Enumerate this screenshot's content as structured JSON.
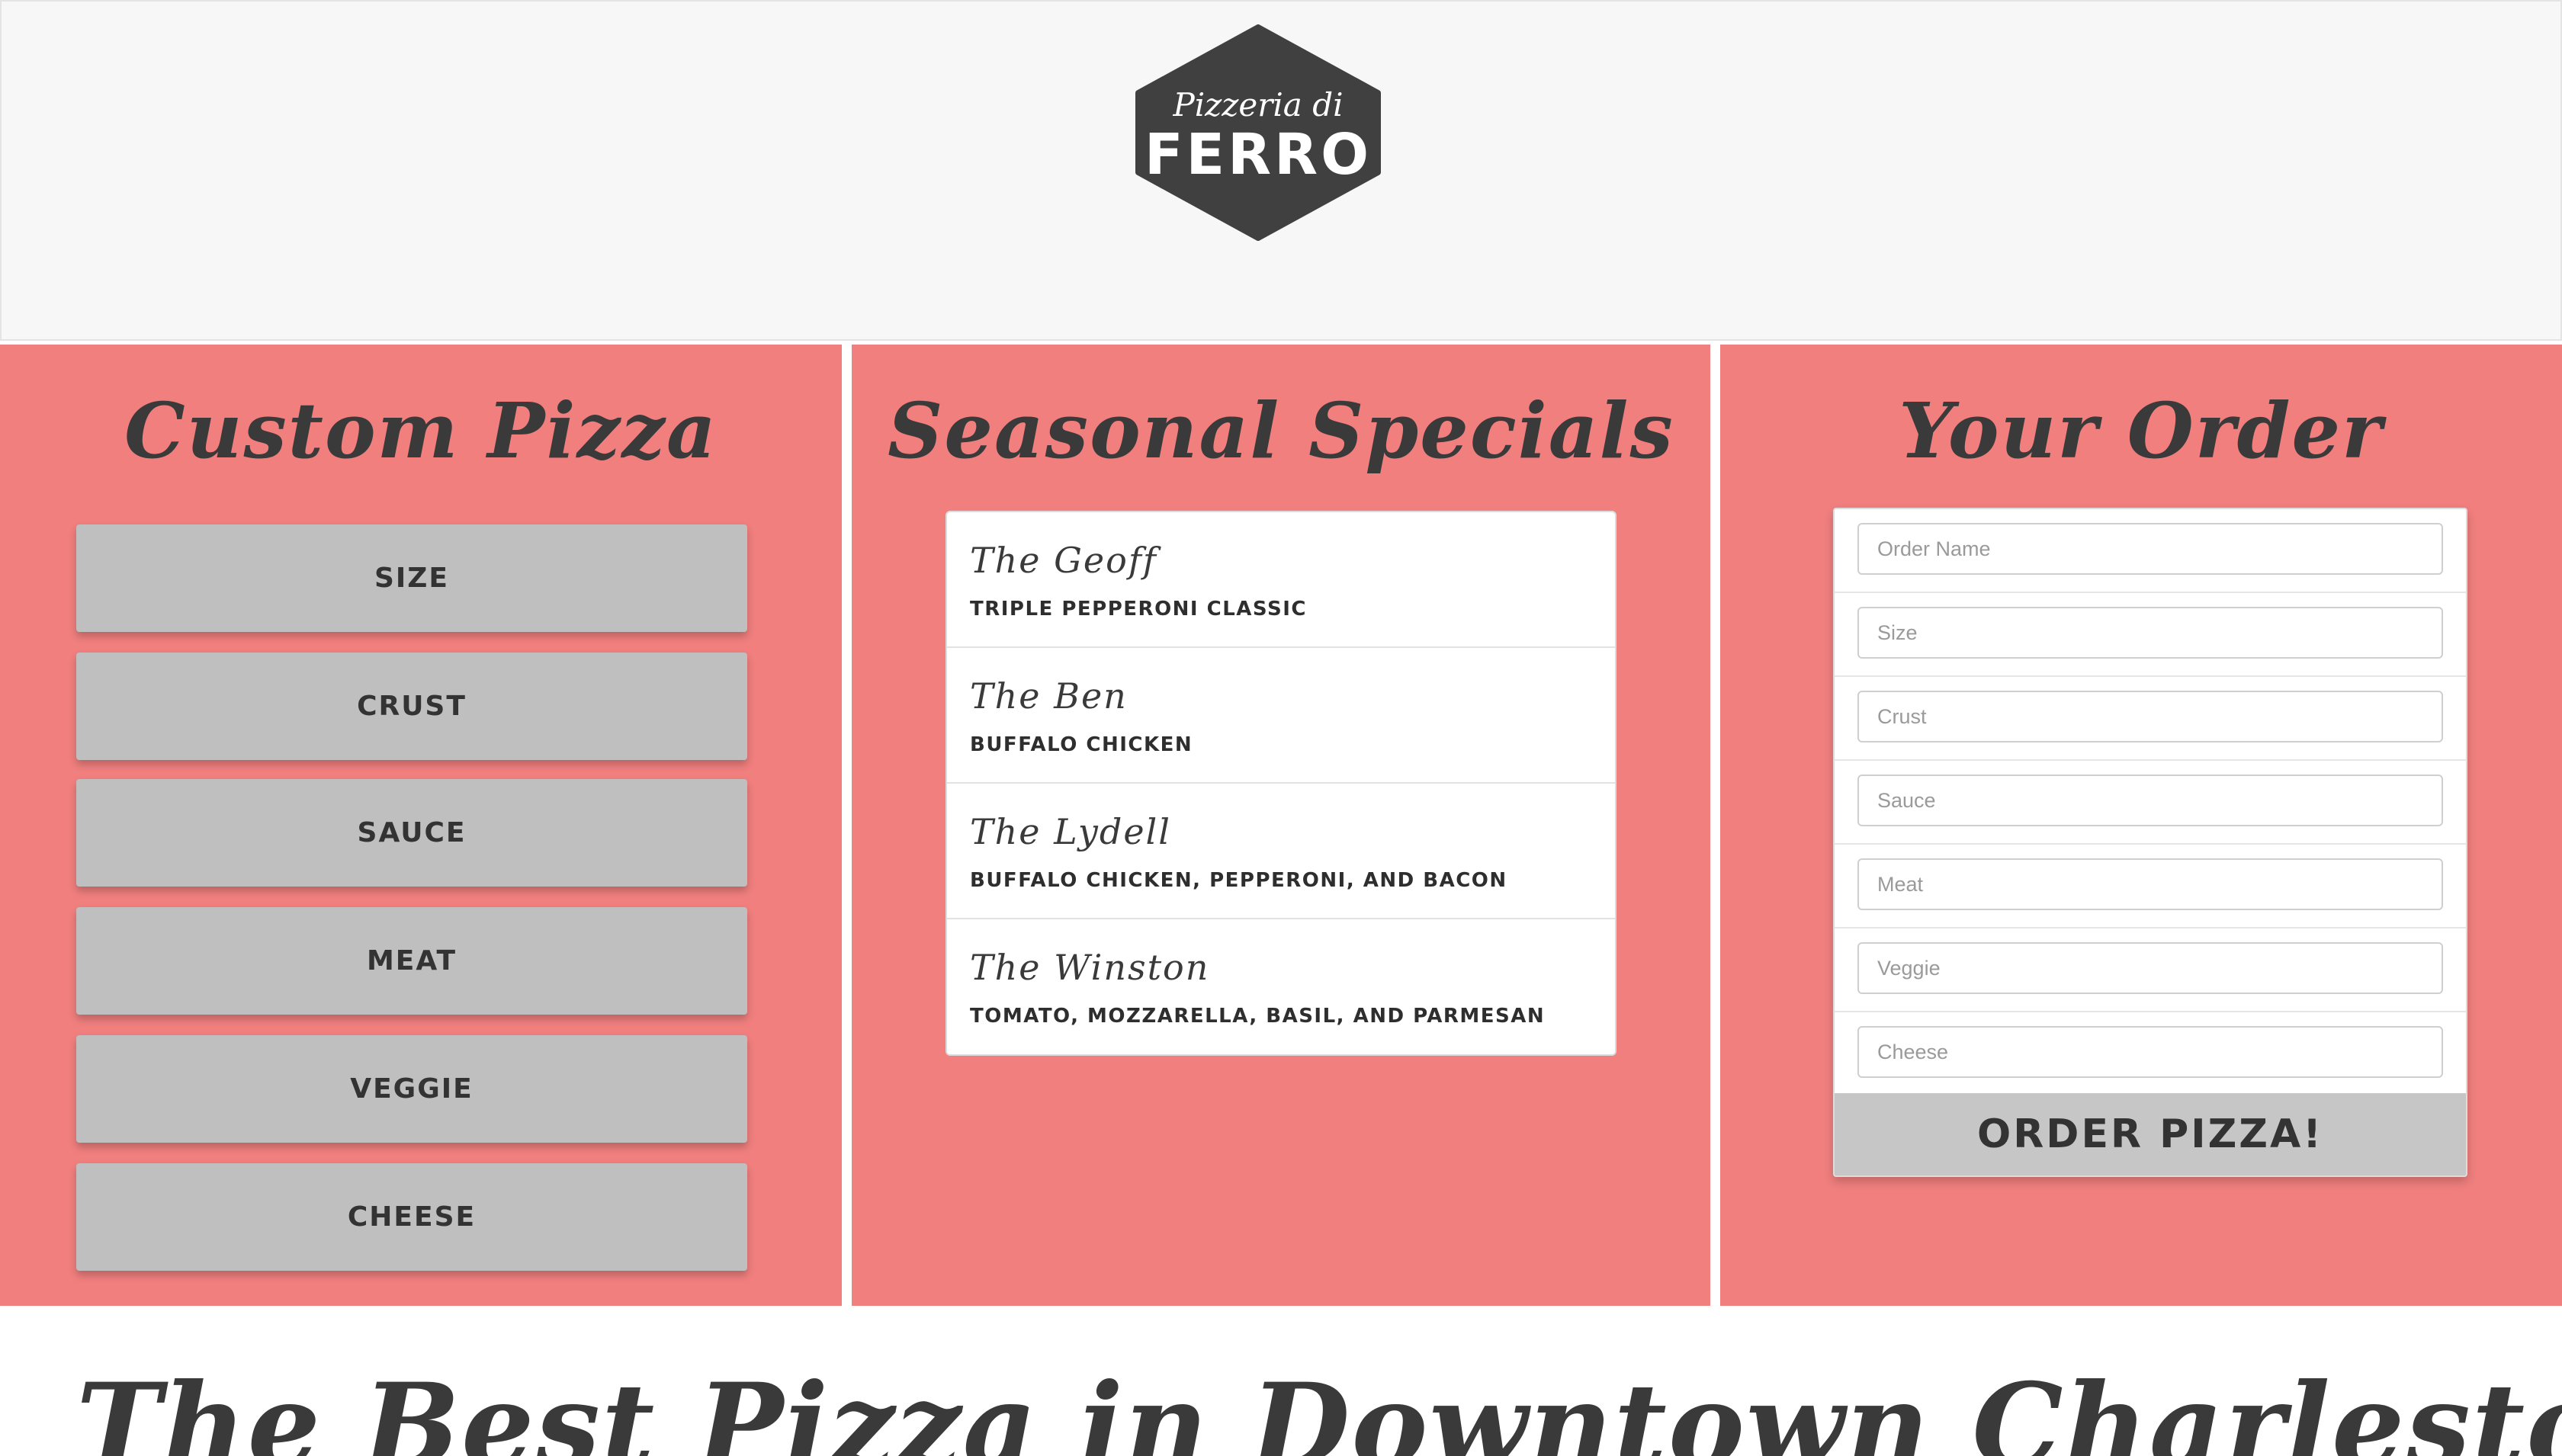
{
  "brand": {
    "logo_script": "Pizzeria di",
    "logo_main": "FERRO"
  },
  "custom": {
    "title": "Custom Pizza",
    "options": [
      "SIZE",
      "CRUST",
      "SAUCE",
      "MEAT",
      "VEGGIE",
      "CHEESE"
    ]
  },
  "specials": {
    "title": "Seasonal Specials",
    "items": [
      {
        "name": "The Geoff",
        "desc": "TRIPLE PEPPERONI CLASSIC"
      },
      {
        "name": "The Ben",
        "desc": "BUFFALO CHICKEN"
      },
      {
        "name": "The Lydell",
        "desc": "BUFFALO CHICKEN, PEPPERONI, AND BACON"
      },
      {
        "name": "The Winston",
        "desc": "TOMATO, MOZZARELLA, BASIL, AND PARMESAN"
      }
    ]
  },
  "order": {
    "title": "Your Order",
    "fields": [
      {
        "placeholder": "Order Name",
        "value": ""
      },
      {
        "placeholder": "Size",
        "value": ""
      },
      {
        "placeholder": "Crust",
        "value": ""
      },
      {
        "placeholder": "Sauce",
        "value": ""
      },
      {
        "placeholder": "Meat",
        "value": ""
      },
      {
        "placeholder": "Veggie",
        "value": ""
      },
      {
        "placeholder": "Cheese",
        "value": ""
      }
    ],
    "submit_label": "ORDER PIZZA!"
  },
  "tagline": "The Best Pizza in Downtown Charleston",
  "colors": {
    "panel": "#f07f7e",
    "header_bg": "#f7f7f7",
    "logo_fill": "#404040",
    "button": "#bfbfbf",
    "text": "#3a3a3a"
  }
}
